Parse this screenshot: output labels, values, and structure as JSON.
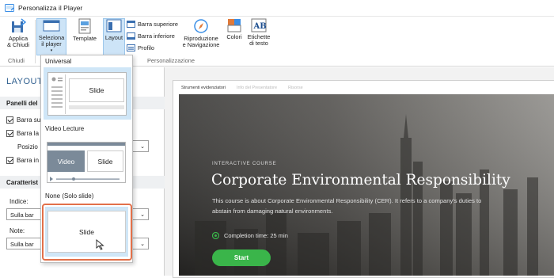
{
  "window": {
    "title": "Personalizza il Player"
  },
  "ribbon": {
    "apply_close": "Applica\n& Chiudi",
    "select_player": "Seleziona\nil player",
    "template": "Template",
    "layout": "Layout",
    "barra_superiore": "Barra superiore",
    "barra_inferiore": "Barra inferiore",
    "profilo": "Profilo",
    "playback": "Riproduzione\ne Navigazione",
    "colors": "Colori",
    "text_labels": "Etichette\ndi testo",
    "group_close": "Chiudi",
    "group_personalize": "Personalizzazione"
  },
  "left_panel": {
    "title": "LAYOUT",
    "section_panels": "Panelli del",
    "check1": "Barra su",
    "check2": "Barra la",
    "position_label": "Posizio",
    "check3": "Barra in",
    "section_chars": "Caratterist",
    "index_label": "Indice:",
    "index_value": "Sulla bar",
    "notes_label": "Note:",
    "notes_value": "Sulla bar"
  },
  "dropdown": {
    "universal": "Universal",
    "universal_slide": "Slide",
    "video_lecture": "Video Lecture",
    "video_label": "Video",
    "video_slide": "Slide",
    "none": "None (Solo slide)",
    "none_slide": "Slide"
  },
  "preview": {
    "tab1": "Strumenti evidenziatori",
    "tab2": "Info del Presentatore",
    "tab3": "Risorse",
    "kicker": "INTERACTIVE COURSE",
    "title": "Corporate Environmental Responsibility",
    "description": "This course is about Corporate Environmental Responsibility (CER). It refers to a company's duties to abstain from damaging natural environments.",
    "time": "Completion time: 25 min",
    "start": "Start"
  },
  "colors": {
    "accent": "#3a8ee6",
    "highlight": "#cde4f7",
    "start_button": "#3ab54a",
    "selected_outline": "#e2704a",
    "left_title": "#2f5f8f"
  }
}
